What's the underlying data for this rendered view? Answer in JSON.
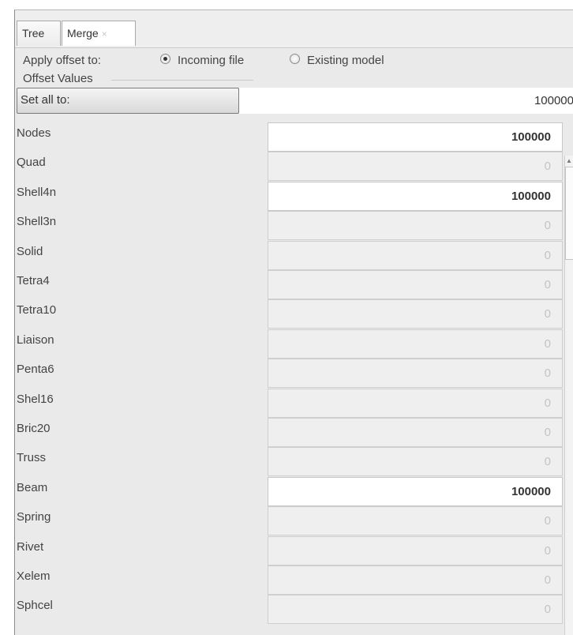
{
  "tabs": [
    {
      "label": "Tree"
    },
    {
      "label": "Merge",
      "close": "×"
    }
  ],
  "apply": {
    "label": "Apply offset to:",
    "options": [
      {
        "label": "Incoming file",
        "checked": true
      },
      {
        "label": "Existing model",
        "checked": false
      }
    ]
  },
  "offset_values": {
    "title": "Offset Values",
    "set_all_label": "Set all to:",
    "set_all_value": "100000",
    "rows": [
      {
        "label": "Nodes",
        "value": "100000",
        "enabled": true
      },
      {
        "label": "Quad",
        "value": "0",
        "enabled": false
      },
      {
        "label": "Shell4n",
        "value": "100000",
        "enabled": true
      },
      {
        "label": "Shell3n",
        "value": "0",
        "enabled": false
      },
      {
        "label": "Solid",
        "value": "0",
        "enabled": false
      },
      {
        "label": "Tetra4",
        "value": "0",
        "enabled": false
      },
      {
        "label": "Tetra10",
        "value": "0",
        "enabled": false
      },
      {
        "label": "Liaison",
        "value": "0",
        "enabled": false
      },
      {
        "label": "Penta6",
        "value": "0",
        "enabled": false
      },
      {
        "label": "Shel16",
        "value": "0",
        "enabled": false
      },
      {
        "label": "Bric20",
        "value": "0",
        "enabled": false
      },
      {
        "label": "Truss",
        "value": "0",
        "enabled": false
      },
      {
        "label": "Beam",
        "value": "100000",
        "enabled": true
      },
      {
        "label": "Spring",
        "value": "0",
        "enabled": false
      },
      {
        "label": "Rivet",
        "value": "0",
        "enabled": false
      },
      {
        "label": "Xelem",
        "value": "0",
        "enabled": false
      },
      {
        "label": "Sphcel",
        "value": "0",
        "enabled": false
      }
    ]
  }
}
